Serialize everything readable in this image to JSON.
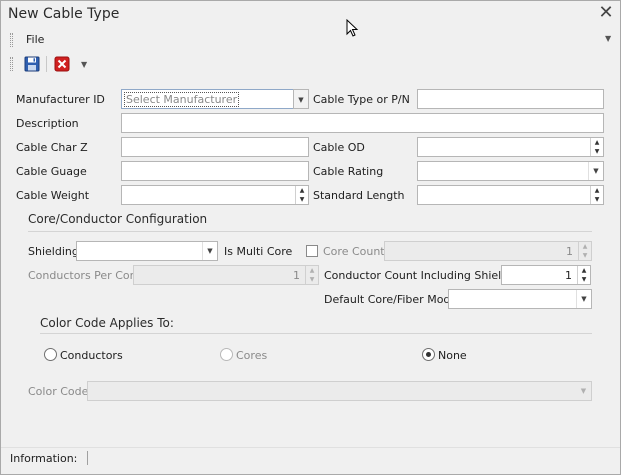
{
  "window": {
    "title": "New Cable Type"
  },
  "menu": {
    "file": "File"
  },
  "toolbar": {
    "save": "floppy-disk-icon",
    "delete": "red-x-icon"
  },
  "form": {
    "manufacturer_id": {
      "label": "Manufacturer ID",
      "placeholder": "Select Manufacturer"
    },
    "cable_type": {
      "label": "Cable Type or P/N",
      "value": ""
    },
    "description": {
      "label": "Description",
      "value": ""
    },
    "cable_char_z": {
      "label": "Cable Char Z",
      "value": ""
    },
    "cable_od": {
      "label": "Cable OD",
      "value": ""
    },
    "cable_guage": {
      "label": "Cable Guage",
      "value": ""
    },
    "cable_rating": {
      "label": "Cable Rating",
      "value": ""
    },
    "cable_weight": {
      "label": "Cable Weight",
      "value": ""
    },
    "standard_length": {
      "label": "Standard Length",
      "value": ""
    }
  },
  "core_config": {
    "title": "Core/Conductor Configuration",
    "shielding": {
      "label": "Shielding",
      "value": ""
    },
    "is_multi_core": {
      "label": "Is Multi Core",
      "checked": false
    },
    "core_count": {
      "label": "Core Count",
      "value": "1"
    },
    "conductors_per_core": {
      "label": "Conductors Per Core",
      "value": "1"
    },
    "conductor_count_shield": {
      "label": "Conductor Count Including Shield(s)",
      "value": "1"
    },
    "default_mode": {
      "label": "Default Core/Fiber Mode",
      "value": ""
    }
  },
  "color_code": {
    "title": "Color Code Applies To:",
    "options": [
      {
        "label": "Conductors",
        "checked": false,
        "enabled": true
      },
      {
        "label": "Cores",
        "checked": false,
        "enabled": false
      },
      {
        "label": "None",
        "checked": true,
        "enabled": true
      }
    ],
    "field_label": "Color Code",
    "value": ""
  },
  "status": {
    "information_label": "Information:"
  },
  "colors": {
    "accent": "#1f4e9a",
    "delete": "#d02020"
  }
}
